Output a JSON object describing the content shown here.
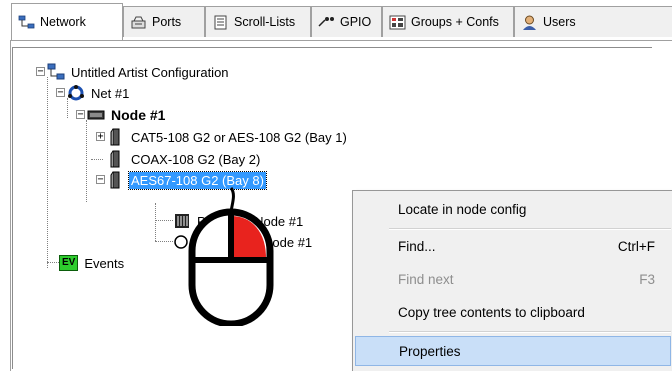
{
  "tabs": [
    {
      "label": "Network",
      "icon": "network-icon",
      "active": true
    },
    {
      "label": "Ports",
      "icon": "ports-icon"
    },
    {
      "label": "Scroll-Lists",
      "icon": "scroll-lists-icon"
    },
    {
      "label": "GPIO",
      "icon": "gpio-icon"
    },
    {
      "label": "Groups + Confs",
      "icon": "groups-icon"
    },
    {
      "label": "Users",
      "icon": "users-icon"
    }
  ],
  "tree": {
    "root": "Untitled Artist Configuration",
    "net": "Net #1",
    "node": "Node #1",
    "card1": "CAT5-108 G2 or AES-108 G2 (Bay  1)",
    "card2": "COAX-108 G2 (Bay  2)",
    "card3": "AES67-108 G2 (Bay  8)",
    "port": "Port 8.1 - Node #1",
    "second_child": "Node #1",
    "events": "Events",
    "events_badge": "EV"
  },
  "context_menu": {
    "items": [
      {
        "label": "Locate in node config",
        "shortcut": ""
      },
      {
        "label": "Find...",
        "shortcut": "Ctrl+F"
      },
      {
        "label": "Find next",
        "shortcut": "F3",
        "disabled": true
      },
      {
        "label": "Copy tree contents to clipboard",
        "shortcut": ""
      },
      {
        "label": "Properties",
        "shortcut": "",
        "highlighted": true
      }
    ]
  },
  "colors": {
    "selection": "#3399ff",
    "menu_hover": "#c9dff8",
    "mouse_button": "#e8231e",
    "events_badge": "#2ecc2e"
  }
}
